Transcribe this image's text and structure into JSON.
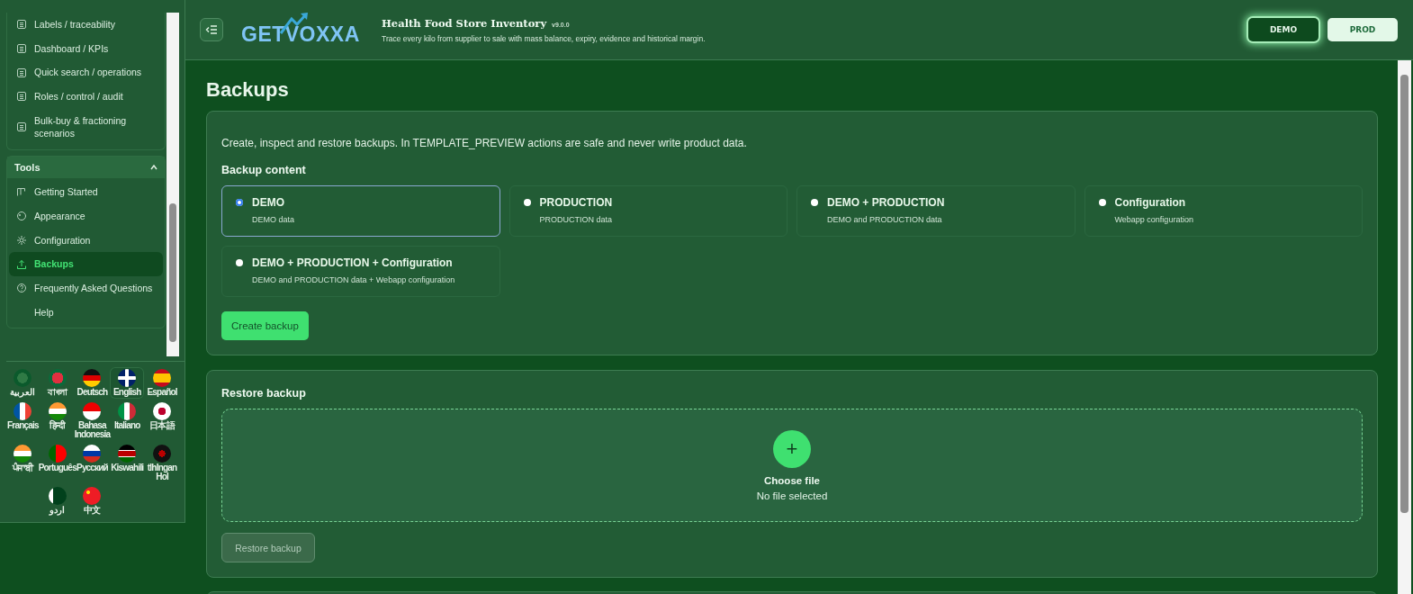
{
  "sidebar": {
    "groups": [
      {
        "items": [
          {
            "label": "Labels / traceability",
            "selected": false
          },
          {
            "label": "Dashboard / KPIs",
            "selected": false
          },
          {
            "label": "Quick search / operations",
            "selected": false
          },
          {
            "label": "Roles / control / audit",
            "selected": false
          },
          {
            "label": "Bulk-buy & fractioning scenarios",
            "selected": false
          }
        ]
      },
      {
        "title": "Tools",
        "expanded": true,
        "items": [
          {
            "label": "Getting Started",
            "selected": false
          },
          {
            "label": "Appearance",
            "selected": false
          },
          {
            "label": "Configuration",
            "selected": false
          },
          {
            "label": "Backups",
            "selected": true
          },
          {
            "label": "Frequently Asked Questions",
            "selected": false
          },
          {
            "label": "Help",
            "selected": false
          }
        ]
      }
    ],
    "languages": [
      {
        "label": "العربية",
        "selected": false
      },
      {
        "label": "বাংলা",
        "selected": false
      },
      {
        "label": "Deutsch",
        "selected": false
      },
      {
        "label": "English",
        "selected": true
      },
      {
        "label": "Español",
        "selected": false
      },
      {
        "label": "Français",
        "selected": false
      },
      {
        "label": "हिन्दी",
        "selected": false
      },
      {
        "label": "Bahasa Indonesia",
        "selected": false
      },
      {
        "label": "Italiano",
        "selected": false
      },
      {
        "label": "日本語",
        "selected": false
      },
      {
        "label": "ਪੰਜਾਬੀ",
        "selected": false
      },
      {
        "label": "Português",
        "selected": false
      },
      {
        "label": "Русский",
        "selected": false
      },
      {
        "label": "Kiswahili",
        "selected": false
      },
      {
        "label": "tlhIngan Hol",
        "selected": false
      },
      {
        "label": "اردو",
        "selected": false
      },
      {
        "label": "中文",
        "selected": false
      }
    ]
  },
  "header": {
    "logo": "GETVOXXA",
    "title": "Health Food Store Inventory",
    "version": "v9.0.0",
    "subtitle": "Trace every kilo from supplier to sale with mass balance, expiry, evidence and historical margin.",
    "env_buttons": [
      {
        "label": "DEMO",
        "selected": true
      },
      {
        "label": "PROD",
        "selected": false
      }
    ]
  },
  "page": {
    "title": "Backups",
    "intro": "Create, inspect and restore backups. In TEMPLATE_PREVIEW actions are safe and never write product data.",
    "content_title": "Backup content",
    "options": [
      {
        "label": "DEMO",
        "description": "DEMO data",
        "selected": true
      },
      {
        "label": "PRODUCTION",
        "description": "PRODUCTION data",
        "selected": false
      },
      {
        "label": "DEMO + PRODUCTION",
        "description": "DEMO and PRODUCTION data",
        "selected": false
      },
      {
        "label": "Configuration",
        "description": "Webapp configuration",
        "selected": false
      },
      {
        "label": "DEMO + PRODUCTION + Configuration",
        "description": "DEMO and PRODUCTION data + Webapp configuration",
        "selected": false
      }
    ],
    "create_button": "Create backup",
    "restore": {
      "title": "Restore backup",
      "add_symbol": "+",
      "choose_label": "Choose file",
      "status": "No file selected",
      "restore_button": {
        "label": "Restore backup",
        "disabled": true
      }
    }
  }
}
